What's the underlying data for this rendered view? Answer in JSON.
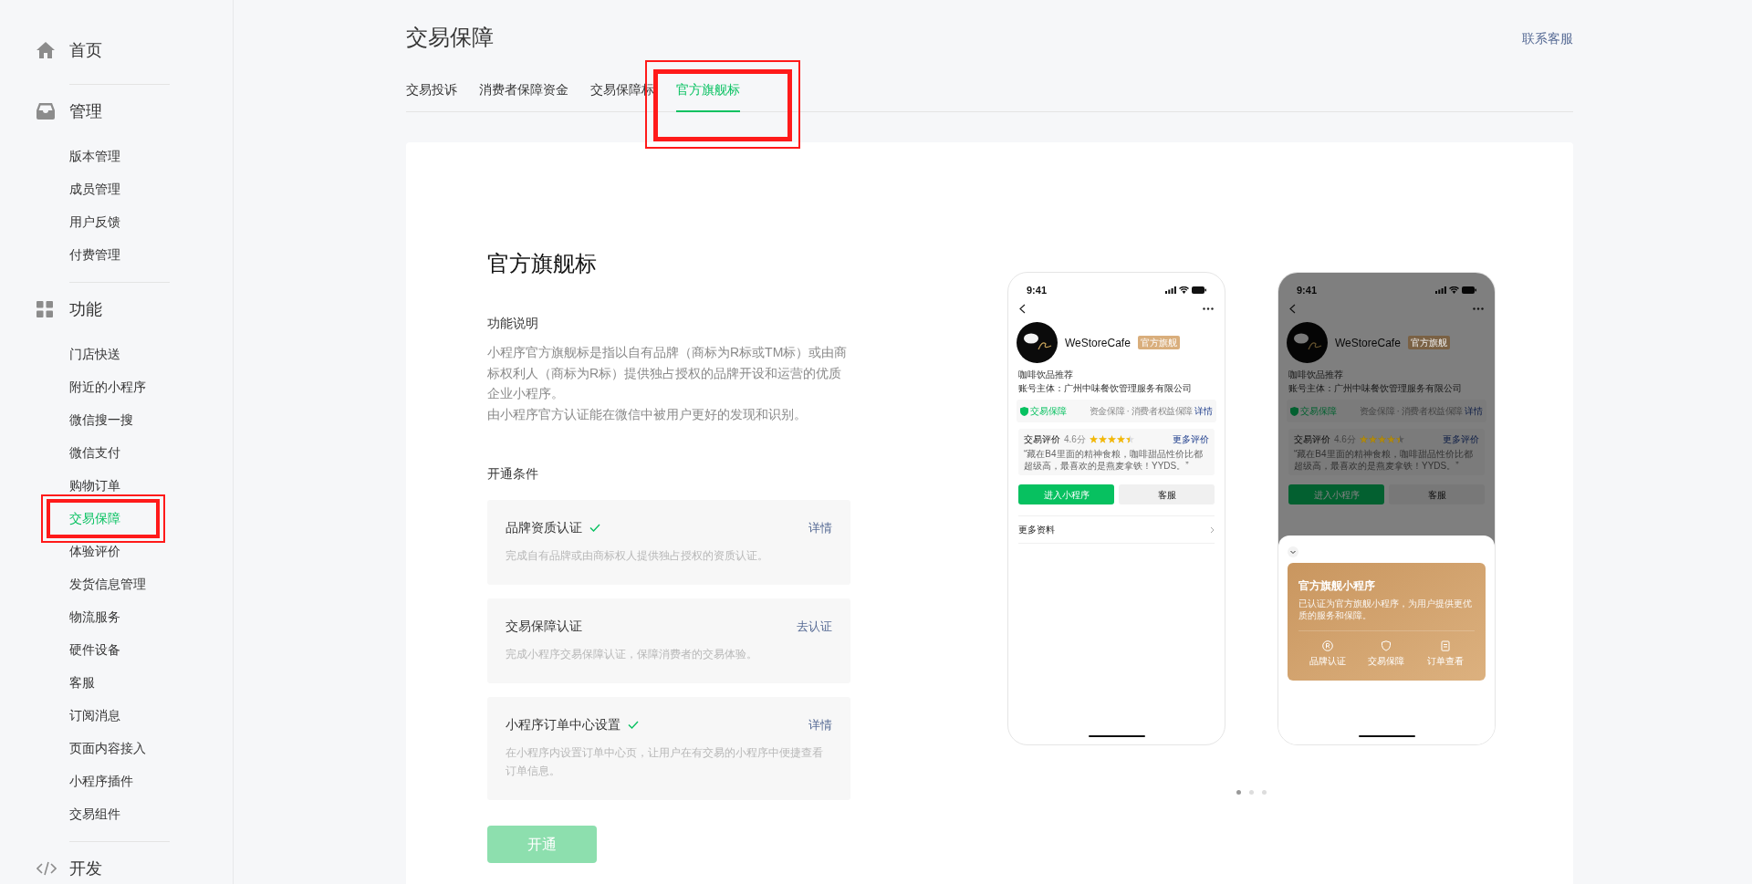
{
  "sidebar": {
    "sections": [
      {
        "label": "首页"
      },
      {
        "label": "管理",
        "items": [
          {
            "label": "版本管理",
            "selected": false
          },
          {
            "label": "成员管理",
            "selected": false
          },
          {
            "label": "用户反馈",
            "selected": false
          },
          {
            "label": "付费管理",
            "selected": false
          }
        ]
      },
      {
        "label": "功能",
        "items": [
          {
            "label": "门店快送",
            "selected": false
          },
          {
            "label": "附近的小程序",
            "selected": false
          },
          {
            "label": "微信搜一搜",
            "selected": false
          },
          {
            "label": "微信支付",
            "selected": false
          },
          {
            "label": "购物订单",
            "selected": false
          },
          {
            "label": "交易保障",
            "selected": true
          },
          {
            "label": "体验评价",
            "selected": false
          },
          {
            "label": "发货信息管理",
            "selected": false
          },
          {
            "label": "物流服务",
            "selected": false
          },
          {
            "label": "硬件设备",
            "selected": false
          },
          {
            "label": "客服",
            "selected": false
          },
          {
            "label": "订阅消息",
            "selected": false
          },
          {
            "label": "页面内容接入",
            "selected": false
          },
          {
            "label": "小程序插件",
            "selected": false
          },
          {
            "label": "交易组件",
            "selected": false
          }
        ]
      },
      {
        "label": "开发"
      }
    ]
  },
  "header": {
    "title": "交易保障",
    "help_link": "联系客服"
  },
  "tabs": [
    {
      "label": "交易投诉",
      "selected": false
    },
    {
      "label": "消费者保障资金",
      "selected": false
    },
    {
      "label": "交易保障标",
      "selected": false
    },
    {
      "label": "官方旗舰标",
      "selected": true
    }
  ],
  "card": {
    "title": "官方旗舰标",
    "description": {
      "heading": "功能说明",
      "paragraphs": [
        "小程序官方旗舰标是指以自有品牌（商标为R标或TM标）或由商标权利人（商标为R标）提供独占授权的品牌开设和运营的优质企业小程序。",
        "由小程序官方认证能在微信中被用户更好的发现和识别。"
      ]
    },
    "conditions": {
      "heading": "开通条件",
      "items": [
        {
          "title": "品牌资质认证",
          "done": true,
          "action": "详情",
          "note": "完成自有品牌或由商标权人提供独占授权的资质认证。"
        },
        {
          "title": "交易保障认证",
          "done": false,
          "action": "去认证",
          "note": "完成小程序交易保障认证，保障消费者的交易体验。"
        },
        {
          "title": "小程序订单中心设置",
          "done": true,
          "action": "详情",
          "note": "在小程序内设置订单中心页，让用户在有交易的小程序中便捷查看订单信息。"
        }
      ]
    },
    "button": {
      "label": "开通",
      "disabled": true
    }
  },
  "phones": [
    {
      "time": "9:41",
      "name": "WeStoreCafe",
      "badge": "官方旗舰",
      "category": "咖啡饮品推荐",
      "subject": "账号主体：广州中味餐饮管理服务有限公司",
      "guarantee": {
        "label": "交易保障",
        "detail": "资金保障 · 消费者权益保障",
        "link": "详情"
      },
      "review": {
        "label": "交易评价",
        "score": "4.6分",
        "stars": 4.5,
        "more": "更多评价",
        "quote": "“藏在B4里面的精神食粮，咖啡甜品性价比都超级高，最喜欢的是燕麦拿铁！YYDS。”"
      },
      "primary": "进入小程序",
      "secondary": "客服",
      "more": "更多资料",
      "dimmed": false
    },
    {
      "time": "9:41",
      "name": "WeStoreCafe",
      "badge": "官方旗舰",
      "category": "咖啡饮品推荐",
      "subject": "账号主体：广州中味餐饮管理服务有限公司",
      "guarantee": {
        "label": "交易保障",
        "detail": "资金保障 · 消费者权益保障",
        "link": "详情"
      },
      "review": {
        "label": "交易评价",
        "score": "4.6分",
        "stars": 4.5,
        "more": "更多评价",
        "quote": "“藏在B4里面的精神食粮，咖啡甜品性价比都超级高，最喜欢的是燕麦拿铁！YYDS。”"
      },
      "primary": "进入小程序",
      "secondary": "客服",
      "dimmed": true,
      "sheet": {
        "title": "官方旗舰小程序",
        "text": "已认证为官方旗舰小程序，为用户提供更优质的服务和保障。",
        "features": [
          "品牌认证",
          "交易保障",
          "订单查看"
        ]
      }
    }
  ],
  "carousel": [
    {
      "selected": true
    },
    {
      "selected": false
    },
    {
      "selected": false
    }
  ]
}
